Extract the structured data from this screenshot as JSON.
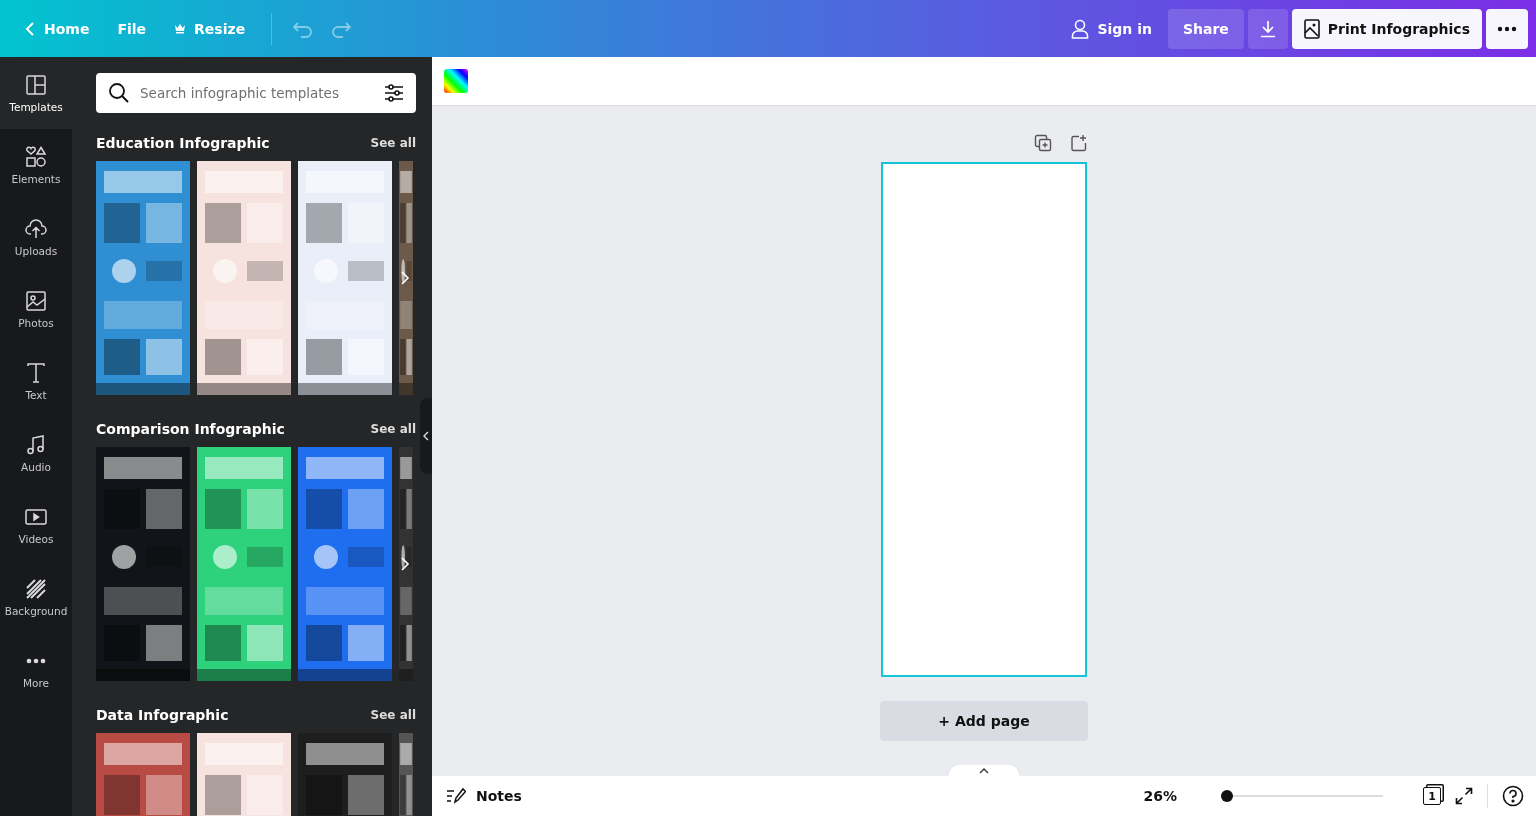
{
  "topbar": {
    "home": "Home",
    "file": "File",
    "resize": "Resize",
    "sign_in": "Sign in",
    "share": "Share",
    "print": "Print Infographics"
  },
  "rail": [
    {
      "label": "Templates",
      "selected": true
    },
    {
      "label": "Elements",
      "selected": false
    },
    {
      "label": "Uploads",
      "selected": false
    },
    {
      "label": "Photos",
      "selected": false
    },
    {
      "label": "Text",
      "selected": false
    },
    {
      "label": "Audio",
      "selected": false
    },
    {
      "label": "Videos",
      "selected": false
    },
    {
      "label": "Background",
      "selected": false
    },
    {
      "label": "More",
      "selected": false
    }
  ],
  "search": {
    "placeholder": "Search infographic templates"
  },
  "sections": [
    {
      "title": "Education Infographic",
      "see_all": "See all"
    },
    {
      "title": "Comparison Infographic",
      "see_all": "See all"
    },
    {
      "title": "Data Infographic",
      "see_all": "See all"
    }
  ],
  "canvas": {
    "add_page": "+ Add page"
  },
  "footer": {
    "notes": "Notes",
    "zoom": "26%",
    "zoom_slider": {
      "level": 0.0
    },
    "page_count": "1"
  }
}
